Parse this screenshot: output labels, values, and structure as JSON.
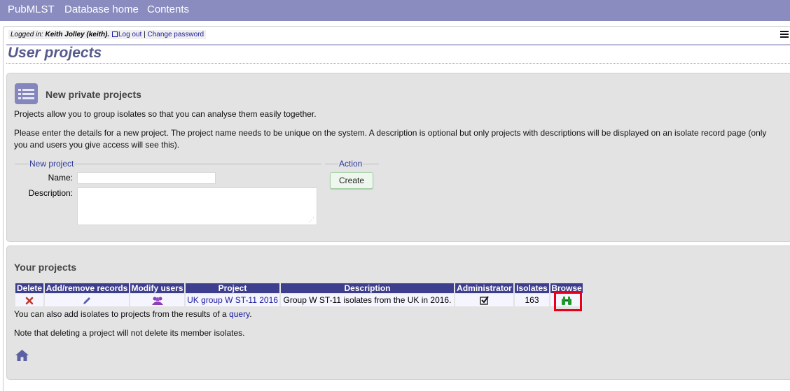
{
  "topnav": {
    "items": [
      "PubMLST",
      "Database home",
      "Contents"
    ]
  },
  "login": {
    "prefix": "Logged in: ",
    "user": "Keith Jolley (keith).",
    "logout": "Log out",
    "sep": " | ",
    "change_password": "Change password"
  },
  "page_title": "User projects",
  "new_projects": {
    "heading": "New private projects",
    "intro": "Projects allow you to group isolates so that you can analyse them easily together.",
    "details_line1": "Please enter the details for a new project. The project name needs to be unique on the system. A description is optional but only projects with descriptions will be displayed on an isolate record page (only",
    "details_line2": "you and users you give access will see this).",
    "fieldset_new": "New project",
    "name_label": "Name:",
    "name_value": "",
    "description_label": "Description:",
    "description_value": "",
    "fieldset_action": "Action",
    "create_label": "Create"
  },
  "your_projects": {
    "heading": "Your projects",
    "columns": [
      "Delete",
      "Add/remove records",
      "Modify users",
      "Project",
      "Description",
      "Administrator",
      "Isolates",
      "Browse"
    ],
    "rows": [
      {
        "project": "UK group W ST-11 2016",
        "description": "Group W ST-11 isolates from the UK in 2016.",
        "administrator": "✔",
        "isolates": "163"
      }
    ],
    "note1_prefix": "You can also add isolates to projects from the results of a ",
    "note1_link": "query",
    "note1_suffix": ".",
    "note2": "Note that deleting a project will not delete its member isolates."
  },
  "icons": {
    "delete": "delete-icon",
    "edit": "pencil-icon",
    "users": "users-icon",
    "admin": "checkbox-checked-icon",
    "browse": "binoculars-icon",
    "home": "home-icon",
    "list": "list-icon",
    "menu": "hamburger-menu-icon"
  },
  "colors": {
    "topbar": "#8a8cbf",
    "table_header": "#3e3e8e",
    "link": "#1a1a9e",
    "delete_red": "#c0392b",
    "browse_green": "#1e9a2a",
    "highlight": "#e8001a"
  }
}
